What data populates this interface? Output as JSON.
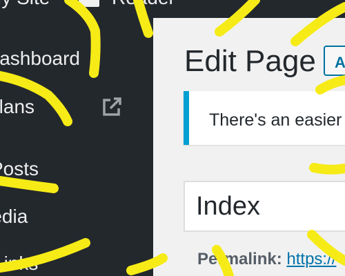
{
  "admin_bar": {
    "site_name": "My Site",
    "reader_label": "Reader"
  },
  "sidebar": {
    "items": [
      {
        "label": "Dashboard",
        "icon": "dashboard-icon"
      },
      {
        "label": "Plans",
        "icon": "plans-icon",
        "external_icon": "external-link-icon"
      },
      {
        "label": "Posts",
        "icon": "posts-icon"
      },
      {
        "label": "Media",
        "icon": "media-icon"
      },
      {
        "label": "Links",
        "icon": "links-icon"
      }
    ]
  },
  "main": {
    "page_title": "Edit Page",
    "add_new_label": "Add New",
    "notice_text": "There's an easier way to edit your pages",
    "title_value": "Index",
    "permalink_label": "Permalink:",
    "permalink_url": "https://"
  },
  "colors": {
    "admin_dark": "#23282d",
    "accent_blue": "#0071a1",
    "notice_border": "#00a0d2",
    "scribble_yellow": "#f6eb16",
    "content_bg": "#f1f1f1"
  }
}
